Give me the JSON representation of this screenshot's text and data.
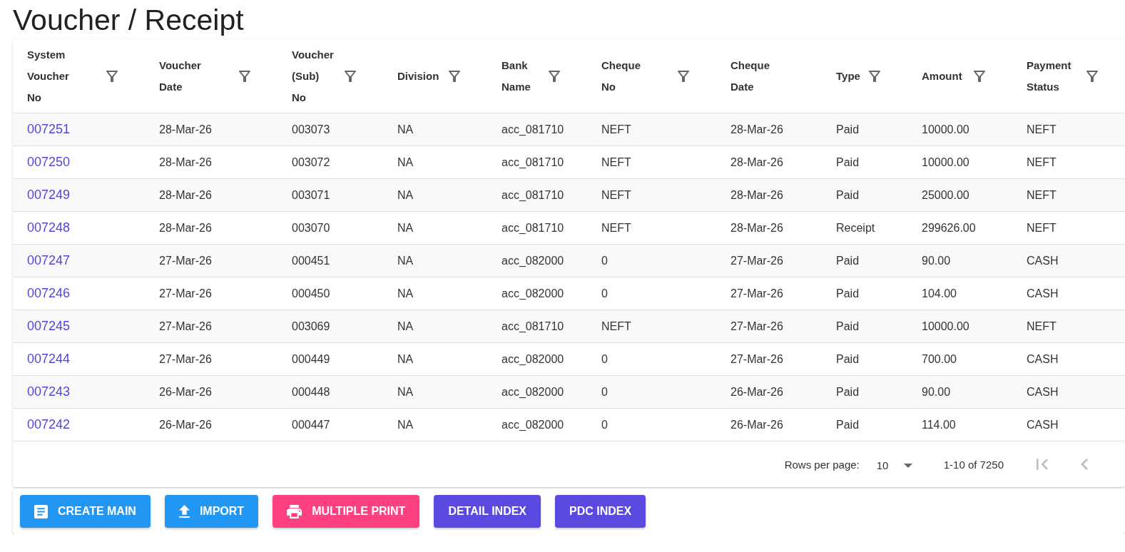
{
  "page": {
    "title": "Voucher / Receipt"
  },
  "table": {
    "columns": [
      {
        "label": "System Voucher No",
        "kind": "link",
        "has_filter": true
      },
      {
        "label": "Voucher Date",
        "kind": "text",
        "has_filter": true
      },
      {
        "label": "Voucher (Sub) No",
        "kind": "text",
        "has_filter": true
      },
      {
        "label": "Division",
        "kind": "text",
        "has_filter": true
      },
      {
        "label": "Bank Name",
        "kind": "text",
        "has_filter": true
      },
      {
        "label": "Cheque No",
        "kind": "text",
        "has_filter": true
      },
      {
        "label": "Cheque Date",
        "kind": "text",
        "has_filter": false
      },
      {
        "label": "Type",
        "kind": "text",
        "has_filter": true
      },
      {
        "label": "Amount",
        "kind": "text",
        "has_filter": true
      },
      {
        "label": "Payment Status",
        "kind": "text",
        "has_filter": true
      }
    ],
    "rows": [
      [
        "007251",
        "28-Mar-26",
        "003073",
        "NA",
        "acc_081710",
        "NEFT",
        "28-Mar-26",
        "Paid",
        "10000.00",
        "NEFT"
      ],
      [
        "007250",
        "28-Mar-26",
        "003072",
        "NA",
        "acc_081710",
        "NEFT",
        "28-Mar-26",
        "Paid",
        "10000.00",
        "NEFT"
      ],
      [
        "007249",
        "28-Mar-26",
        "003071",
        "NA",
        "acc_081710",
        "NEFT",
        "28-Mar-26",
        "Paid",
        "25000.00",
        "NEFT"
      ],
      [
        "007248",
        "28-Mar-26",
        "003070",
        "NA",
        "acc_081710",
        "NEFT",
        "28-Mar-26",
        "Receipt",
        "299626.00",
        "NEFT"
      ],
      [
        "007247",
        "27-Mar-26",
        "000451",
        "NA",
        "acc_082000",
        "0",
        "27-Mar-26",
        "Paid",
        "90.00",
        "CASH"
      ],
      [
        "007246",
        "27-Mar-26",
        "000450",
        "NA",
        "acc_082000",
        "0",
        "27-Mar-26",
        "Paid",
        "104.00",
        "CASH"
      ],
      [
        "007245",
        "27-Mar-26",
        "003069",
        "NA",
        "acc_081710",
        "NEFT",
        "27-Mar-26",
        "Paid",
        "10000.00",
        "NEFT"
      ],
      [
        "007244",
        "27-Mar-26",
        "000449",
        "NA",
        "acc_082000",
        "0",
        "27-Mar-26",
        "Paid",
        "700.00",
        "CASH"
      ],
      [
        "007243",
        "26-Mar-26",
        "000448",
        "NA",
        "acc_082000",
        "0",
        "26-Mar-26",
        "Paid",
        "90.00",
        "CASH"
      ],
      [
        "007242",
        "26-Mar-26",
        "000447",
        "NA",
        "acc_082000",
        "0",
        "26-Mar-26",
        "Paid",
        "114.00",
        "CASH"
      ]
    ]
  },
  "pagination": {
    "rows_per_page_label": "Rows per page:",
    "rows_per_page": "10",
    "range": "1-10 of 7250",
    "nav_buttons": [
      {
        "kind": "first",
        "disabled": true
      },
      {
        "kind": "prev",
        "disabled": true
      }
    ]
  },
  "buttons": [
    {
      "label": "CREATE MAIN",
      "kind": "create",
      "color": "#2196f3"
    },
    {
      "label": "IMPORT",
      "kind": "import",
      "color": "#2196f3"
    },
    {
      "label": "MULTIPLE PRINT",
      "kind": "print",
      "color": "#ff4081"
    },
    {
      "label": "DETAIL INDEX",
      "kind": "index",
      "color": "#5a4ae0"
    },
    {
      "label": "PDC INDEX",
      "kind": "index",
      "color": "#5a4ae0"
    }
  ]
}
